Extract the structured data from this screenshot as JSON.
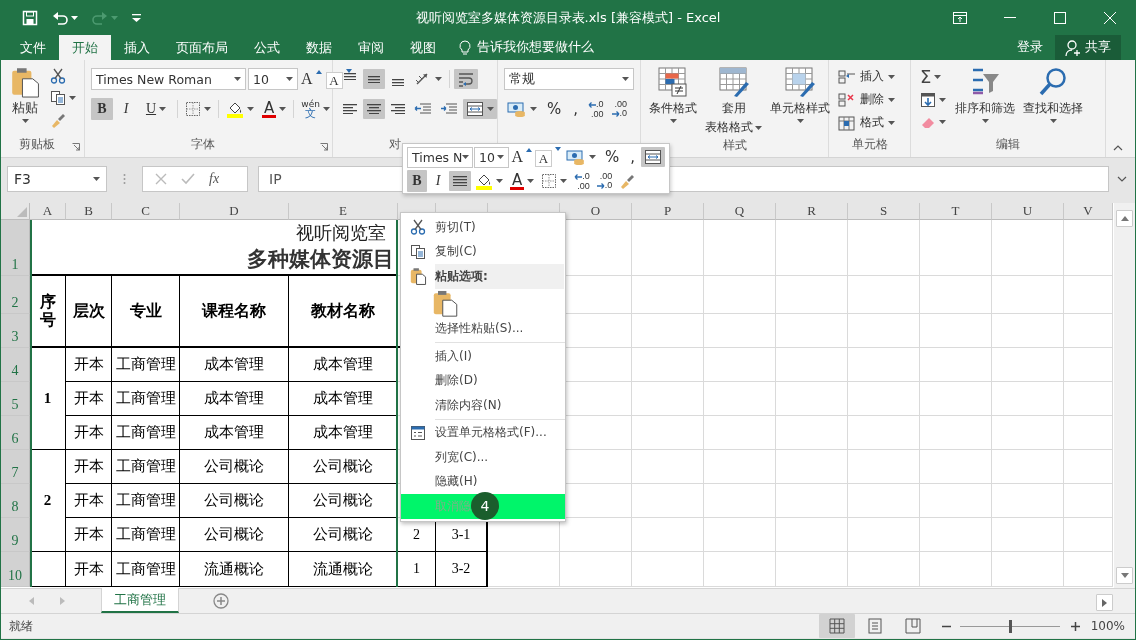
{
  "title_bar": {
    "title": "视听阅览室多媒体资源目录表.xls  [兼容模式] - Excel",
    "redo_disabled": true
  },
  "ribbon_tabs": [
    {
      "label": "文件",
      "selected": false
    },
    {
      "label": "开始",
      "selected": true
    },
    {
      "label": "插入",
      "selected": false
    },
    {
      "label": "页面布局",
      "selected": false
    },
    {
      "label": "公式",
      "selected": false
    },
    {
      "label": "数据",
      "selected": false
    },
    {
      "label": "审阅",
      "selected": false
    },
    {
      "label": "视图",
      "selected": false
    }
  ],
  "tell_me": "告诉我你想要做什么",
  "account": {
    "sign_in": "登录",
    "share": "共享"
  },
  "ribbon": {
    "clipboard": {
      "paste": "粘贴",
      "label": "剪贴板"
    },
    "font": {
      "name": "Times New Roman",
      "size": "10",
      "grow": "A",
      "shrink": "A",
      "bold": {
        "text": "B",
        "pressed": true
      },
      "italic": {
        "text": "I",
        "pressed": false
      },
      "underline": {
        "text": "U",
        "pressed": false
      },
      "font_color": "A",
      "phonetic": "wén",
      "phonetic_char": "文",
      "label": "字体"
    },
    "alignment": {
      "top_pressed": false,
      "middle_pressed": true,
      "bottom_pressed": false,
      "wrap_pressed": true,
      "left_pressed": false,
      "center_pressed": true,
      "right_pressed": false,
      "merge_pressed": true,
      "label": "对"
    },
    "number": {
      "format": "常规",
      "percent": "%",
      "comma": ",",
      "decimals": [
        {
          "top": ".0",
          "bottom": ".00"
        },
        {
          "top": ".00",
          "bottom": ".0"
        }
      ]
    },
    "styles": {
      "buttons": [
        {
          "kind": "conditional",
          "lines": [
            "条件格式"
          ]
        },
        {
          "kind": "table",
          "lines": [
            "套用",
            "表格格式"
          ]
        },
        {
          "kind": "cell",
          "lines": [
            "单元格样式"
          ]
        }
      ],
      "label": "样式"
    },
    "cells": {
      "buttons": [
        {
          "kind": "insert",
          "label": "插入"
        },
        {
          "kind": "delete",
          "label": "删除"
        },
        {
          "kind": "format",
          "label": "格式"
        }
      ],
      "label": "单元格"
    },
    "editing": {
      "autosum": "Σ",
      "buttons": [
        {
          "kind": "sort",
          "label": "排序和筛选"
        },
        {
          "kind": "find",
          "label": "查找和选择"
        }
      ],
      "label": "编辑"
    }
  },
  "formula_bar": {
    "name_box": "F3",
    "function_button": "fx",
    "formula": "IP"
  },
  "mini_toolbar": {
    "font_name": "Times N",
    "font_size": "10",
    "grow": "A",
    "shrink": "A",
    "percent": "%",
    "comma": ",",
    "merge_pressed": true,
    "bold": {
      "text": "B",
      "pressed": true
    },
    "italic": {
      "text": "I",
      "pressed": false
    },
    "center_pressed": true,
    "font_color": "A",
    "decimals": [
      {
        "top": ".0",
        "bottom": ".00"
      },
      {
        "top": ".00",
        "bottom": ".0"
      }
    ]
  },
  "sheet": {
    "columns": [
      {
        "label": "A"
      },
      {
        "label": "B"
      },
      {
        "label": "C"
      },
      {
        "label": "D"
      },
      {
        "label": "E"
      },
      {},
      {},
      {},
      {
        "label": "O"
      },
      {
        "label": "P"
      },
      {
        "label": "Q"
      },
      {
        "label": "R"
      },
      {
        "label": "S"
      },
      {
        "label": "T"
      },
      {
        "label": "U"
      },
      {
        "label": "V"
      }
    ],
    "rows": [
      {
        "label": "1",
        "selected": true
      },
      {
        "label": "2",
        "selected": true
      },
      {
        "label": "3",
        "selected": true
      },
      {
        "label": "4",
        "selected": true
      },
      {
        "label": "5",
        "selected": true
      },
      {
        "label": "6",
        "selected": true
      },
      {
        "label": "7",
        "selected": true
      },
      {
        "label": "8",
        "selected": true
      },
      {
        "label": "9",
        "selected": true
      },
      {
        "label": "10",
        "selected": true
      }
    ],
    "title": "视听阅览室",
    "subtitle": "多种媒体资源目",
    "headings": [
      "序号",
      "层次",
      "专业",
      "课程名称",
      "教材名称"
    ],
    "groups": [
      {
        "number": "1",
        "rows": [
          {
            "cells": [
              "开本",
              "工商管理",
              "成本管理",
              "成本管理"
            ]
          },
          {
            "cells": [
              "开本",
              "工商管理",
              "成本管理",
              "成本管理"
            ]
          },
          {
            "cells": [
              "开本",
              "工商管理",
              "成本管理",
              "成本管理"
            ]
          }
        ]
      },
      {
        "number": "2",
        "rows": [
          {
            "cells": [
              "开本",
              "工商管理",
              "公司概论",
              "公司概论"
            ]
          },
          {
            "cells": [
              "开本",
              "工商管理",
              "公司概论",
              "公司概论"
            ]
          },
          {
            "cells": [
              "开本",
              "工商管理",
              "公司概论",
              "公司概论"
            ],
            "extra": [
              "2",
              "3-1"
            ]
          }
        ]
      },
      {
        "rows": [
          {
            "cells": [
              "开本",
              "工商管理",
              "流通概论",
              "流通概论"
            ],
            "extra": [
              "1",
              "3-2"
            ]
          }
        ]
      }
    ]
  },
  "context_menu": {
    "items": [
      {
        "kind": "cut",
        "label": "剪切(T)",
        "selected": false
      },
      {
        "kind": "copy",
        "label": "复制(C)",
        "selected": false
      },
      {
        "kind": "pasteheader",
        "label": "粘贴选项:"
      },
      {
        "kind": "pasteoptions"
      },
      {
        "kind": "item",
        "label": "选择性粘贴(S)...",
        "selected": false
      },
      {
        "kind": "separator"
      },
      {
        "kind": "item",
        "label": "插入(I)",
        "selected": false
      },
      {
        "kind": "item",
        "label": "删除(D)",
        "selected": false
      },
      {
        "kind": "item",
        "label": "清除内容(N)",
        "selected": false
      },
      {
        "kind": "separator"
      },
      {
        "kind": "format",
        "label": "设置单元格格式(F)...",
        "selected": false
      },
      {
        "kind": "item",
        "label": "列宽(C)...",
        "selected": false
      },
      {
        "kind": "item",
        "label": "隐藏(H)",
        "selected": false
      },
      {
        "kind": "item",
        "label": "取消隐",
        "selected": true,
        "badge": "4"
      }
    ]
  },
  "sheet_tabs": [
    {
      "label": "工商管理",
      "selected": true
    }
  ],
  "status_bar": {
    "status": "就绪",
    "views": [
      {
        "kind": "normal",
        "selected": true
      },
      {
        "kind": "layout",
        "selected": false
      },
      {
        "kind": "breaks",
        "selected": false
      }
    ],
    "zoom": {
      "level": 0.5,
      "reading": "100%"
    }
  }
}
